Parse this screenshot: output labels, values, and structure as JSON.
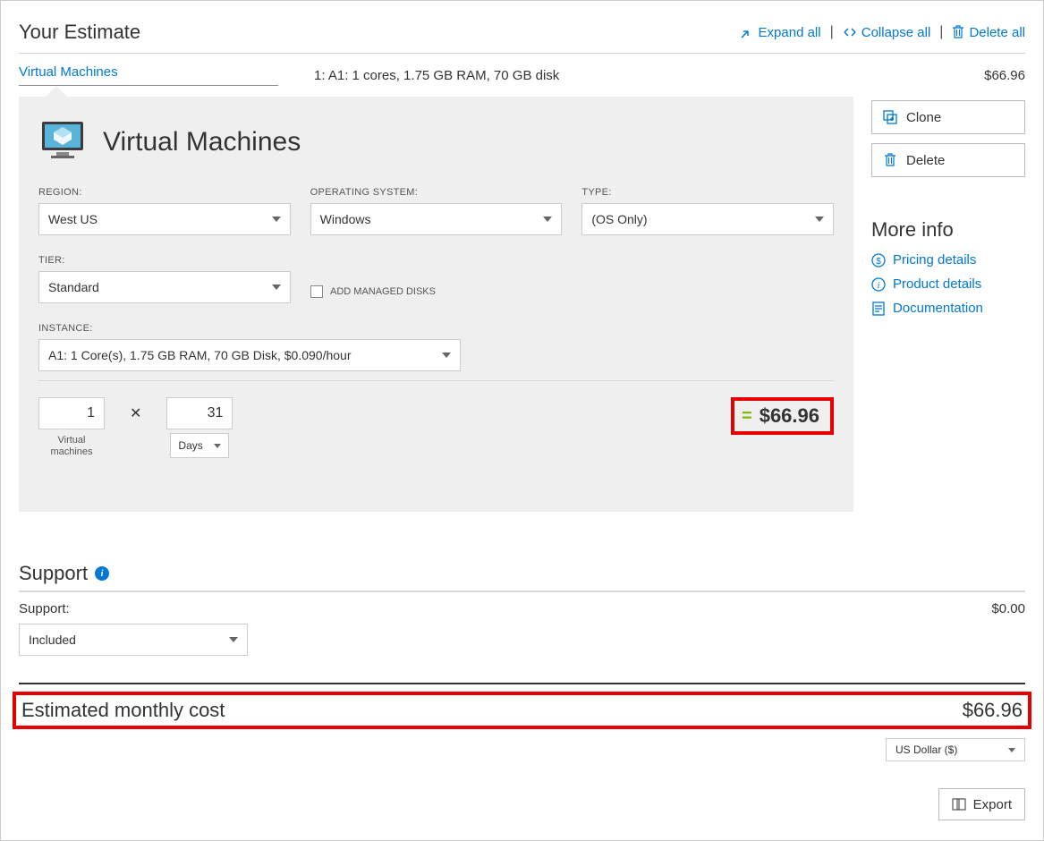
{
  "header": {
    "title": "Your Estimate",
    "expand": "Expand all",
    "collapse": "Collapse all",
    "delete_all": "Delete all"
  },
  "summary": {
    "service": "Virtual Machines",
    "desc": "1: A1: 1 cores, 1.75 GB RAM, 70 GB disk",
    "price": "$66.96"
  },
  "panel": {
    "title": "Virtual Machines",
    "labels": {
      "region": "REGION:",
      "os": "OPERATING SYSTEM:",
      "type": "TYPE:",
      "tier": "TIER:",
      "instance": "INSTANCE:",
      "managed": "ADD MANAGED DISKS"
    },
    "values": {
      "region": "West US",
      "os": "Windows",
      "type": "(OS Only)",
      "tier": "Standard",
      "instance": "A1: 1 Core(s), 1.75 GB RAM, 70 GB Disk, $0.090/hour"
    },
    "calc": {
      "vm_count": "1",
      "vm_caption": "Virtual\nmachines",
      "duration": "31",
      "unit": "Days",
      "result": "$66.96"
    }
  },
  "side": {
    "clone": "Clone",
    "delete": "Delete",
    "more_info": "More info",
    "pricing": "Pricing details",
    "product": "Product details",
    "docs": "Documentation"
  },
  "support": {
    "heading": "Support",
    "label": "Support:",
    "cost": "$0.00",
    "value": "Included"
  },
  "final": {
    "label": "Estimated monthly cost",
    "value": "$66.96",
    "currency": "US Dollar ($)",
    "export": "Export"
  }
}
